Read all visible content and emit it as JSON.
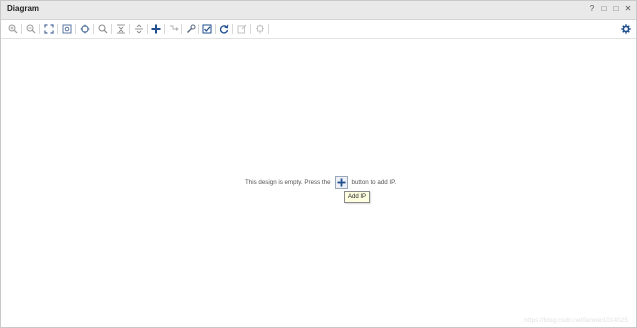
{
  "window": {
    "title": "Diagram",
    "controls": [
      "?",
      "□",
      "□",
      "✕"
    ]
  },
  "toolbar": {
    "icons": [
      "zoom-in-icon",
      "zoom-out-icon",
      "fit-full-icon",
      "zoom-fit-icon",
      "target-icon",
      "search-icon",
      "collapse-all-icon",
      "expand-all-icon",
      "add-ip-icon",
      "autoconnect-icon",
      "wrench-icon",
      "validate-icon",
      "refresh-icon",
      "regenerate-icon",
      "pin-icon",
      "settings-icon"
    ]
  },
  "canvas": {
    "message_before": "This design is empty. Press the",
    "message_after": "button to add IP.",
    "tooltip": "Add IP",
    "watermark": "https://blog.csdn.net/lanwei1014025"
  },
  "colors": {
    "accent": "#1f4f8f",
    "titlebar": "#e9e9e9",
    "tooltip_bg": "#ffffe1"
  }
}
